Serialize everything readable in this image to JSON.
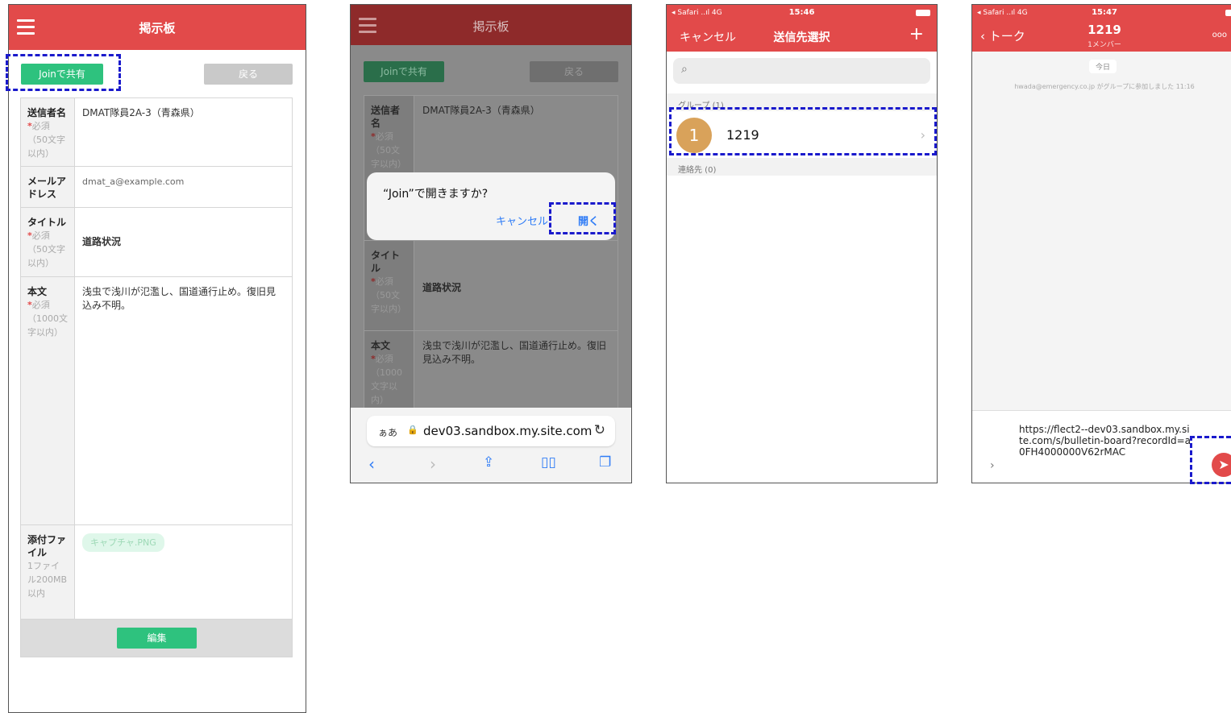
{
  "panel1": {
    "header_title": "掲示板",
    "share_button": "Joinで共有",
    "back_button": "戻る",
    "fields": {
      "sender": {
        "label": "送信者名",
        "required": "必須",
        "limit": "（50文字以内）",
        "value": "DMAT隊員2A-3（青森県）"
      },
      "email": {
        "label": "メールアドレス",
        "value": "dmat_a@example.com"
      },
      "title": {
        "label": "タイトル",
        "required": "必須",
        "limit": "（50文字以内）",
        "value": "道路状況"
      },
      "body": {
        "label": "本文",
        "required": "必須",
        "limit": "（1000文字以内）",
        "value": "浅虫で浅川が氾濫し、国道通行止め。復旧見込み不明。"
      },
      "attachment": {
        "label": "添付ファイル",
        "limit": "1ファイル200MB以内",
        "value": "キャプチャ.PNG"
      }
    },
    "edit_button": "編集"
  },
  "panel2": {
    "header_title": "掲示板",
    "share_button": "Joinで共有",
    "back_button": "戻る",
    "sender_label": "送信者名",
    "required": "必須",
    "limit50": "（50文字以内）",
    "limit1000": "（1000文字以内）",
    "sender_value": "DMAT隊員2A-3（青森県）",
    "title_label": "タイトル",
    "title_value": "道路状況",
    "body_label": "本文",
    "body_value": "浅虫で浅川が氾濫し、国道通行止め。復旧見込み不明。",
    "dialog": {
      "title": "“Join”で開きますか?",
      "cancel": "キャンセル",
      "open": "開く"
    },
    "urlbar": {
      "aa": "ぁあ",
      "url": "dev03.sandbox.my.site.com"
    }
  },
  "panel3": {
    "status": {
      "carrier": "◂ Safari ..ıl 4G",
      "time": "15:46"
    },
    "nav": {
      "cancel": "キャンセル",
      "title": "送信先選択",
      "add": "+"
    },
    "groups_header": "グループ (1)",
    "group": {
      "avatar": "1",
      "name": "1219"
    },
    "contacts_header": "連絡先 (0)"
  },
  "panel4": {
    "status": {
      "carrier": "◂ Safari ..ıl 4G",
      "time": "15:47"
    },
    "nav": {
      "back": "トーク",
      "title": "1219",
      "subtitle": "1メンバー"
    },
    "today": "今日",
    "joined_message": "hwada@emergency.co.jp がグループに参加しました 11:16",
    "composer_text": "https://flect2--dev03.sandbox.my.site.com/s/bulletin-board?recordId=a0FH4000000V62rMAC"
  }
}
